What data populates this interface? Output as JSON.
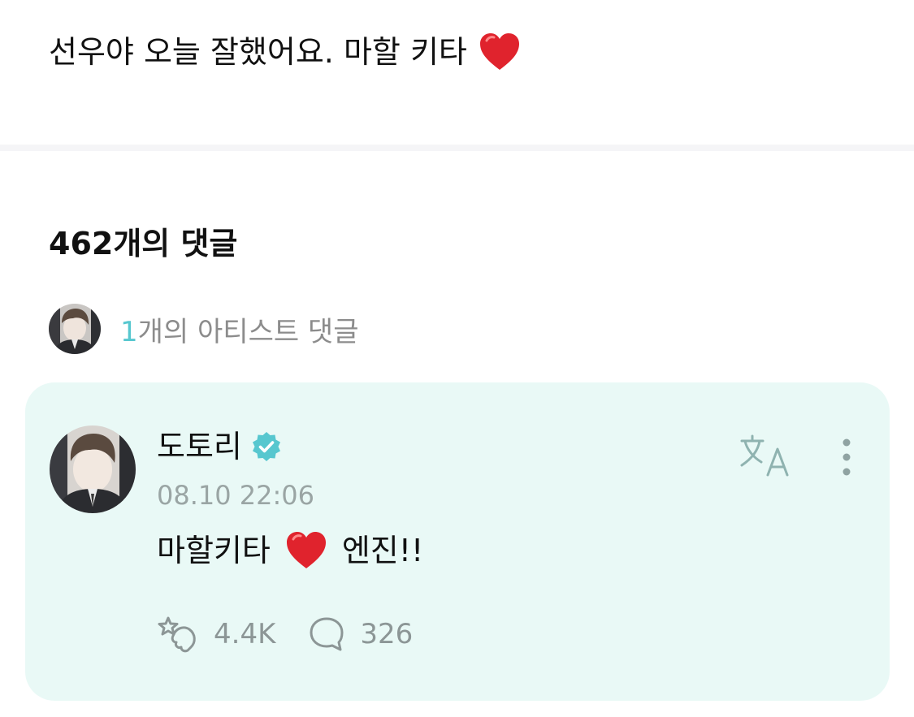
{
  "post": {
    "text": "선우야 오늘 잘했어요. 마할 키타"
  },
  "comments": {
    "title": "462개의 댓글",
    "artist_count": "1",
    "artist_label": "개의 아티스트 댓글"
  },
  "comment": {
    "author": "도토리",
    "timestamp": "08.10 22:06",
    "text_before": "마할키타",
    "text_after": "엔진!!",
    "likes": "4.4K",
    "replies": "326"
  },
  "colors": {
    "accent": "#57c7cf",
    "card_bg": "#e9f9f6",
    "heart": "#e0232d"
  },
  "icons": [
    "heart-emoji-icon",
    "verified-badge-icon",
    "translate-icon",
    "more-options-icon",
    "cheer-like-icon",
    "reply-bubble-icon"
  ]
}
